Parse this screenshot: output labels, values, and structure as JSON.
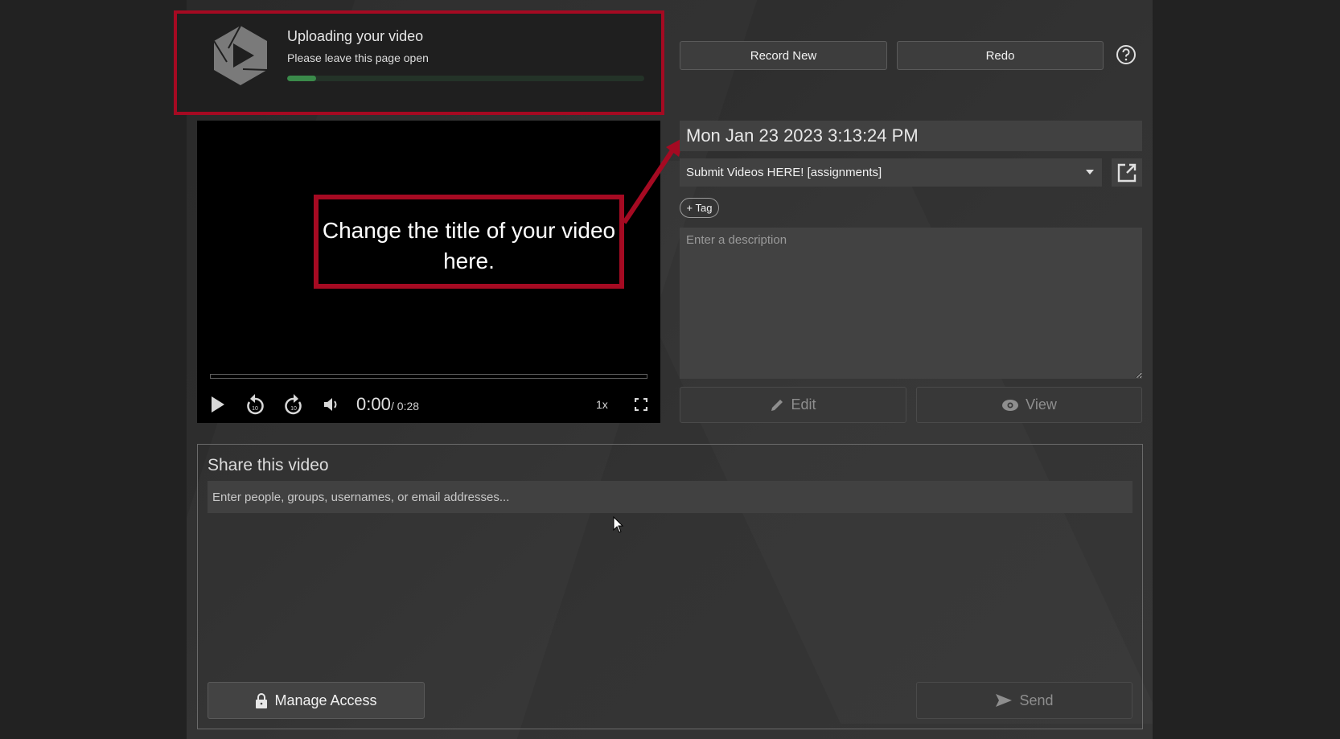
{
  "upload": {
    "title": "Uploading your video",
    "subtitle": "Please leave this page open",
    "progress_percent": 8,
    "logo_icon": "panopto-logo-icon",
    "accent_color": "#3a8a4a"
  },
  "toolbar": {
    "record_new_label": "Record New",
    "redo_label": "Redo",
    "help_icon": "help-circle-icon"
  },
  "player": {
    "current_time": "0:00",
    "duration": "/ 0:28",
    "speed": "1x",
    "progress_percent": 0,
    "icons": [
      "play-icon",
      "rewind-10-icon",
      "forward-10-icon",
      "volume-icon",
      "fullscreen-icon"
    ]
  },
  "annotation": {
    "callout_text": "Change the title of your video here.",
    "highlight_color": "#a50a22"
  },
  "form": {
    "title_value": "Mon Jan 23 2023 3:13:24 PM",
    "folder_value": "Submit Videos HERE! [assignments]",
    "tag_label": "+ Tag",
    "description_placeholder": "Enter a description",
    "edit_label": "Edit",
    "view_label": "View"
  },
  "share": {
    "title": "Share this video",
    "input_placeholder": "Enter people, groups, usernames, or email addresses...",
    "manage_access_label": "Manage Access",
    "send_label": "Send"
  }
}
